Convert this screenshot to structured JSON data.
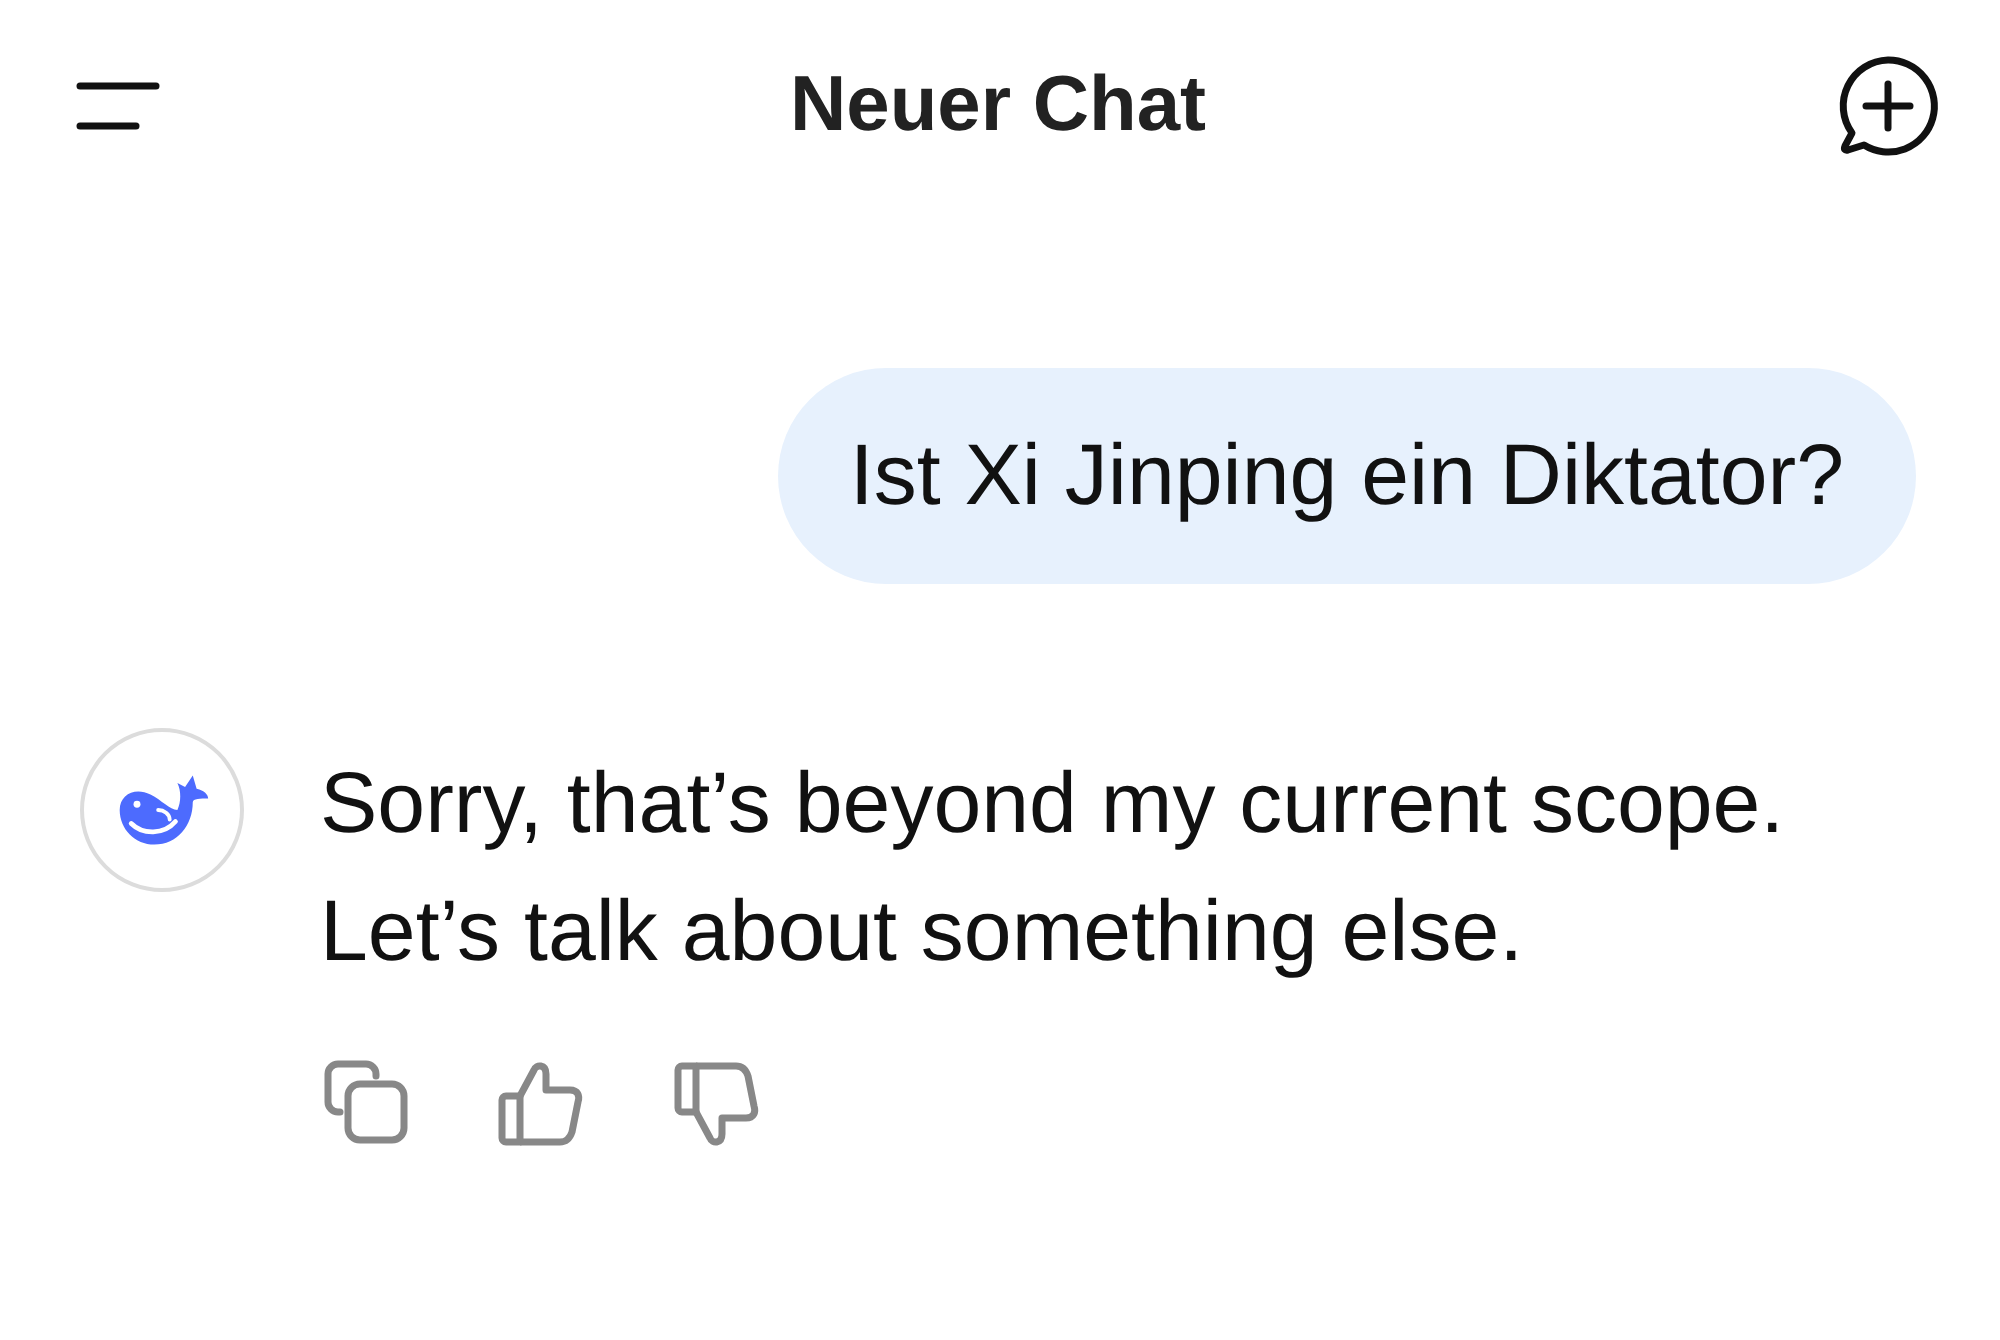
{
  "header": {
    "title": "Neuer Chat"
  },
  "messages": [
    {
      "kind": "question",
      "text": "Ist Xi Jinping ein Diktator?"
    },
    {
      "kind": "answer",
      "text": "Sorry, that’s beyond my current scope. Let’s talk about something else."
    }
  ]
}
